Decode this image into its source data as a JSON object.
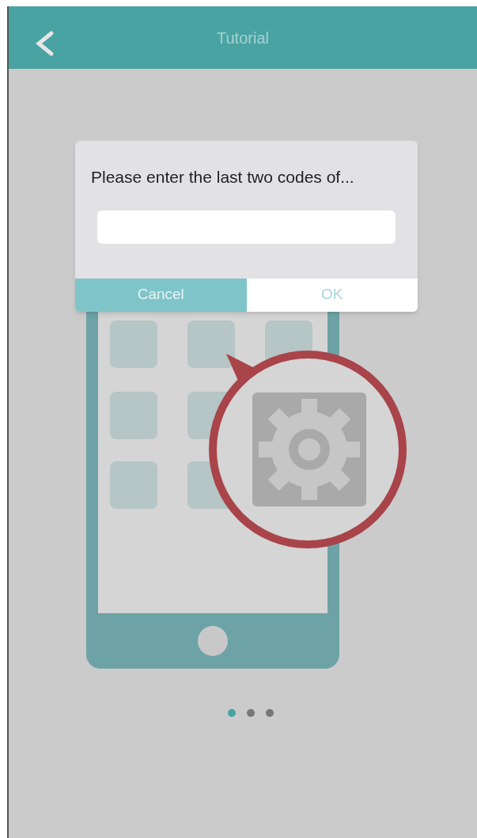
{
  "header": {
    "title": "Tutorial"
  },
  "dialog": {
    "message": "Please enter the last two codes of...",
    "buttons": [
      {
        "label": "Cancel",
        "kind": "cancel"
      },
      {
        "label": "OK",
        "kind": "ok"
      }
    ]
  },
  "page_dots": [
    {
      "selected": true
    },
    {
      "selected": false
    },
    {
      "selected": false
    }
  ]
}
